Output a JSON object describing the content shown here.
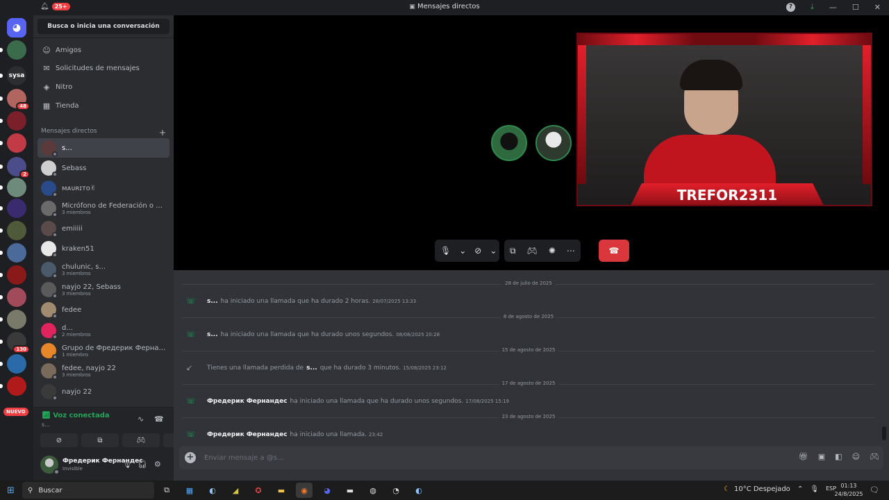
{
  "titlebar": {
    "title": "Mensajes directos",
    "notif_badge": "25+"
  },
  "rail": {
    "servers": [
      {
        "name": "discord-home",
        "color": "#5865f2",
        "label": ""
      },
      {
        "name": "server-1",
        "color": "#3a6b4a",
        "label": ""
      },
      {
        "name": "server-sysa",
        "color": "#2b2d31",
        "label": "sysa"
      },
      {
        "name": "server-2",
        "color": "#b0665f",
        "label": "",
        "count": "48"
      },
      {
        "name": "server-3",
        "color": "#7b1f2a",
        "label": ""
      },
      {
        "name": "server-4",
        "color": "#c23a45",
        "label": ""
      },
      {
        "name": "server-5",
        "color": "#4b4c8a",
        "label": "",
        "count": "2"
      },
      {
        "name": "server-6",
        "color": "#6e8a7a",
        "label": ""
      },
      {
        "name": "server-7",
        "color": "#3a2a6e",
        "label": ""
      },
      {
        "name": "server-8",
        "color": "#4e5a3a",
        "label": ""
      },
      {
        "name": "server-9",
        "color": "#4a6a9a",
        "label": ""
      },
      {
        "name": "server-10",
        "color": "#8a1a1a",
        "label": ""
      },
      {
        "name": "server-11",
        "color": "#a04a5a",
        "label": ""
      },
      {
        "name": "server-12",
        "color": "#7a7a6a",
        "label": ""
      },
      {
        "name": "server-13",
        "color": "#3a3a3a",
        "label": "",
        "count": "130"
      },
      {
        "name": "server-14",
        "color": "#2b6aa8",
        "label": ""
      },
      {
        "name": "server-15",
        "color": "#b01a1a",
        "label": ""
      }
    ],
    "nuevo": "NUEVO"
  },
  "sidebar": {
    "search": "Busca o inicia una conversación",
    "nav": [
      {
        "label": "Amigos",
        "icon": "person-wave-icon",
        "glyph": "☺"
      },
      {
        "label": "Solicitudes de mensajes",
        "icon": "mail-icon",
        "glyph": "✉"
      },
      {
        "label": "Nitro",
        "icon": "nitro-icon",
        "glyph": "◈"
      },
      {
        "label": "Tienda",
        "icon": "shop-icon",
        "glyph": "▦"
      }
    ],
    "dm_header": "Mensajes directos",
    "dms": [
      {
        "name": "s...",
        "sub": "",
        "color": "#5a3a3a",
        "active": true
      },
      {
        "name": "Sebass",
        "sub": "",
        "color": "#cfcfcf"
      },
      {
        "name": "ᴍᴀᴜʀɪᴛᴏ✌",
        "sub": "",
        "color": "#2a4a8a"
      },
      {
        "name": "Micrófono de Federación o M...",
        "sub": "3 miembros",
        "color": "#6a6a6a"
      },
      {
        "name": "emiiiii",
        "sub": "",
        "color": "#5a4a4a"
      },
      {
        "name": "kraken51",
        "sub": "",
        "color": "#e8e8e8"
      },
      {
        "name": "chulunic, s...",
        "sub": "3 miembros",
        "color": "#4a5a6a"
      },
      {
        "name": "nayjo 22, Sebass",
        "sub": "3 miembros",
        "color": "#5a5a5a"
      },
      {
        "name": "fedee",
        "sub": "",
        "color": "#a08a70"
      },
      {
        "name": "d...",
        "sub": "2 miembros",
        "color": "#e0245e"
      },
      {
        "name": "Grupo de Фредерик Фернан...",
        "sub": "1 miembro",
        "color": "#e8862a"
      },
      {
        "name": "fedee, nayjo 22",
        "sub": "3 miembros",
        "color": "#7a6a5a"
      },
      {
        "name": "nayjo 22",
        "sub": "",
        "color": "#3a3a3a"
      }
    ]
  },
  "voice": {
    "status": "Voz conectada",
    "channel": "s..."
  },
  "user": {
    "name": "Фредерик Фернандес",
    "status": "Invisible"
  },
  "call": {
    "streamer_name": "TREFOR2311"
  },
  "messages": [
    {
      "type": "divider",
      "label": "28 de julio de 2025"
    },
    {
      "type": "call",
      "who": "s...",
      "text": "ha iniciado una llamada que ha durado 2 horas.",
      "ts": "28/07/2025 13:33"
    },
    {
      "type": "divider",
      "label": "8 de agosto de 2025"
    },
    {
      "type": "call",
      "who": "s...",
      "text": "ha iniciado una llamada que ha durado unos segundos.",
      "ts": "08/08/2025 20:28"
    },
    {
      "type": "divider",
      "label": "15 de agosto de 2025"
    },
    {
      "type": "missed",
      "pre": "Tienes una llamada perdida de",
      "who": "s...",
      "text": "que ha durado 3 minutos.",
      "ts": "15/08/2025 23:12"
    },
    {
      "type": "divider",
      "label": "17 de agosto de 2025"
    },
    {
      "type": "call",
      "who": "Фредерик Фернандес",
      "text": "ha iniciado una llamada que ha durado unos segundos.",
      "ts": "17/08/2025 15:19"
    },
    {
      "type": "divider",
      "label": "23 de agosto de 2025"
    },
    {
      "type": "call",
      "who": "Фредерик Фернандес",
      "text": "ha iniciado una llamada.",
      "ts": "23:42"
    }
  ],
  "composer": {
    "placeholder": "Enviar mensaje a @s..."
  },
  "taskbar": {
    "search": "Buscar",
    "weather": "10°C  Despejado",
    "lang": "ESP",
    "time": "01:13",
    "date": "24/8/2025"
  }
}
